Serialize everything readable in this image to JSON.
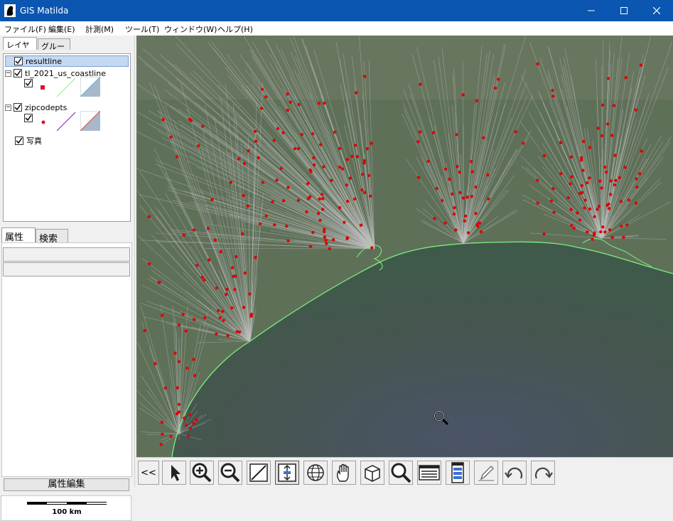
{
  "window": {
    "title": "GIS Matilda"
  },
  "menu": [
    "ファイル(F)",
    "編集(E)",
    "計測(M)",
    "ツール(T)",
    "ウィンドウ(W)",
    "ヘルプ(H)"
  ],
  "layer_tabs": [
    "レイヤー",
    "グループ"
  ],
  "layers": [
    {
      "name": "resultline",
      "checked": true,
      "selected": true
    },
    {
      "name": "tl_2021_us_coastline",
      "checked": true,
      "expanded": true
    },
    {
      "name": "zipcodepts",
      "checked": true,
      "expanded": true
    },
    {
      "name": "写真",
      "checked": true
    }
  ],
  "attr_tabs": [
    "属性",
    "検索"
  ],
  "attr_edit_label": "属性編集",
  "scale": {
    "label": "100 km"
  },
  "toolbar": {
    "collapse_label": "<<",
    "tools": [
      "select-arrow-icon",
      "zoom-in-icon",
      "zoom-out-icon",
      "line-draw-icon",
      "vertical-measure-icon",
      "globe-icon",
      "pan-hand-icon",
      "3d-box-icon",
      "search-magnifier-icon",
      "attribute-table-icon",
      "layer-panel-icon",
      "edit-pencil-icon",
      "undo-icon",
      "redo-icon"
    ]
  },
  "colors": {
    "titlebar": "#0a56b0",
    "points": "#e00000",
    "coastline": "#7cf07c",
    "lines": "#c0c0c0"
  }
}
